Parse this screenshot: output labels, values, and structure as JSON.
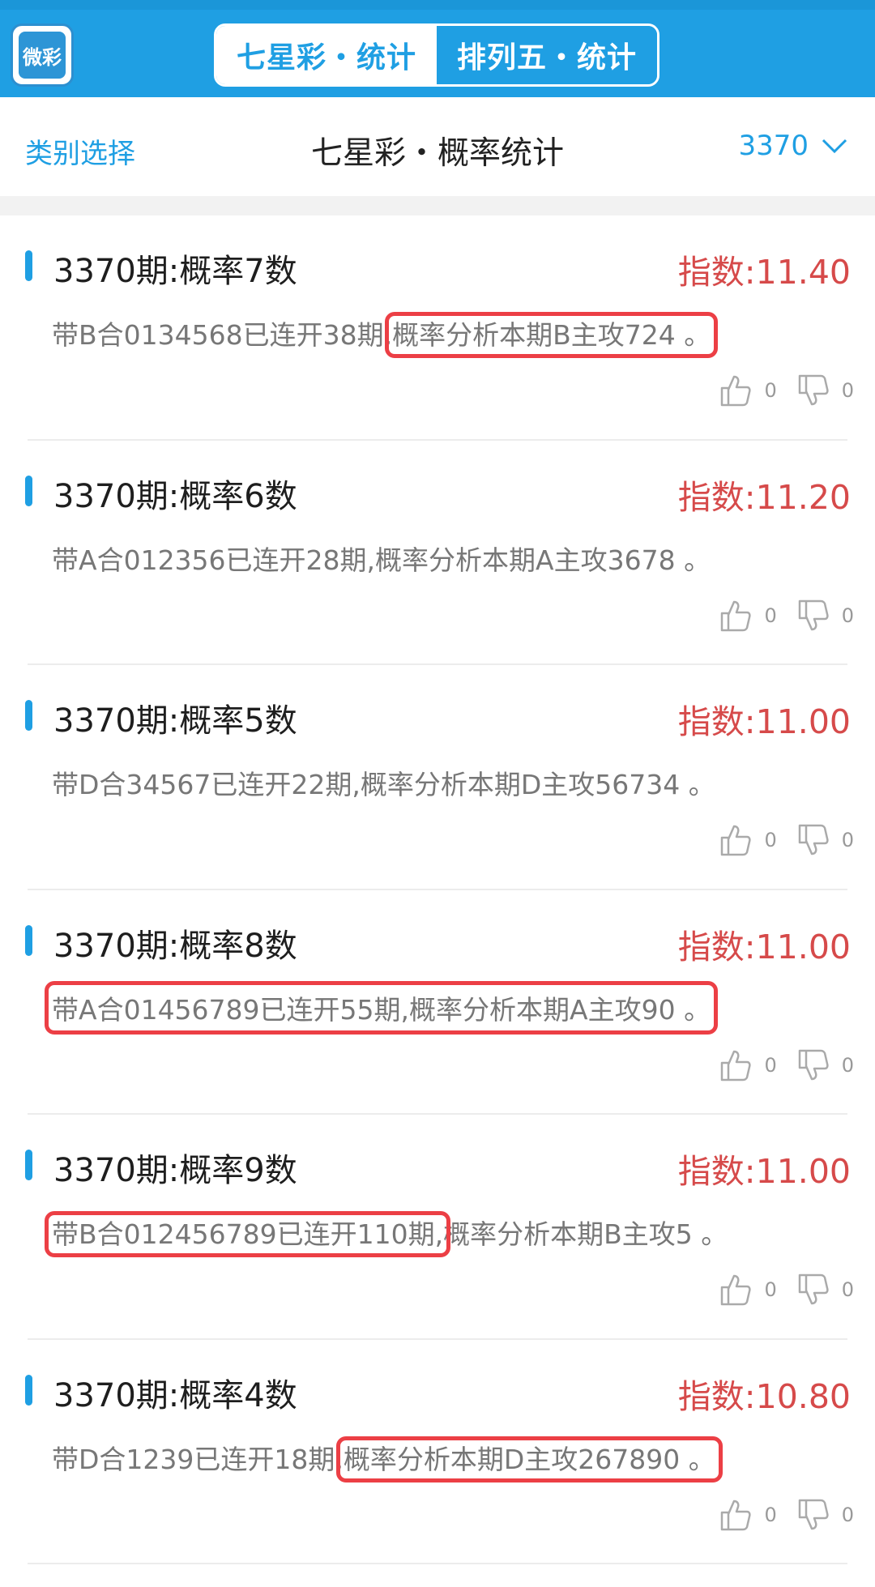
{
  "app": {
    "logo_text": "微彩",
    "tabs": [
      {
        "label": "七星彩・统计",
        "active": true
      },
      {
        "label": "排列五・统计",
        "active": false
      }
    ]
  },
  "subheader": {
    "category_label": "类别选择",
    "title": "七星彩・概率统计",
    "issue": "3370"
  },
  "colors": {
    "primary": "#1f9fe3",
    "index_red": "#d64a4a",
    "highlight_red": "#ec3f45"
  },
  "cards": [
    {
      "title": "3370期:概率7数",
      "index": "指数:11.40",
      "body_a": "带B合0134568已连开38期,",
      "body_b": "概率分析本期B主攻724 。",
      "likes": "0",
      "dislikes": "0"
    },
    {
      "title": "3370期:概率6数",
      "index": "指数:11.20",
      "body_a": "带A合012356已连开28期,",
      "body_b": "概率分析本期A主攻3678 。",
      "likes": "0",
      "dislikes": "0"
    },
    {
      "title": "3370期:概率5数",
      "index": "指数:11.00",
      "body_a": "带D合34567已连开22期,",
      "body_b": "概率分析本期D主攻56734 。",
      "likes": "0",
      "dislikes": "0"
    },
    {
      "title": "3370期:概率8数",
      "index": "指数:11.00",
      "body_a": "带A合01456789已连开55期,",
      "body_b": "概率分析本期A主攻90 。",
      "likes": "0",
      "dislikes": "0"
    },
    {
      "title": "3370期:概率9数",
      "index": "指数:11.00",
      "body_a": "带B合012456789已连开110期,",
      "body_b": "概率分析本期B主攻5 。",
      "likes": "0",
      "dislikes": "0"
    },
    {
      "title": "3370期:概率4数",
      "index": "指数:10.80",
      "body_a": "带D合1239已连开18期,",
      "body_b": "概率分析本期D主攻267890 。",
      "likes": "0",
      "dislikes": "0"
    }
  ]
}
